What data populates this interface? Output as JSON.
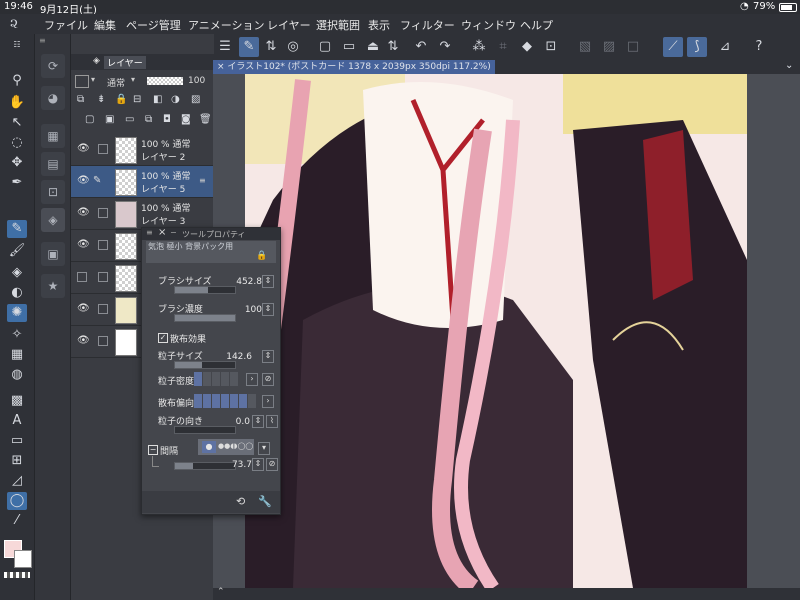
{
  "status": {
    "time": "19:46",
    "date": "9月12日(土)",
    "battery": "79%"
  },
  "menu": [
    "ファイル",
    "編集",
    "ページ管理",
    "アニメーション",
    "レイヤー",
    "選択範囲",
    "表示",
    "フィルター",
    "ウィンドウ",
    "ヘルプ"
  ],
  "layer_panel": {
    "title": "レイヤー",
    "blend_mode": "通常",
    "opacity": "100",
    "layers": [
      {
        "line1": "100 % 通常",
        "line2": "レイヤー 2",
        "selected": false
      },
      {
        "line1": "100 % 通常",
        "line2": "レイヤー 5",
        "selected": true
      },
      {
        "line1": "100 % 通常",
        "line2": "レイヤー 3",
        "selected": false
      }
    ]
  },
  "document": {
    "tab_title": "イラスト102* (ポストカード 1378 x 2039px 350dpi 117.2%)"
  },
  "tool_property": {
    "title": "ツールプロパティ",
    "subtitle": "気泡 極小 背景パック用",
    "brush_size_label": "ブラシサイズ",
    "brush_size_value": "452.8",
    "brush_size_fill": 0.55,
    "brush_density_label": "ブラシ濃度",
    "brush_density_value": "100",
    "brush_density_fill": 1.0,
    "scatter_label": "散布効果",
    "particle_size_label": "粒子サイズ",
    "particle_size_value": "142.6",
    "particle_size_fill": 0.45,
    "particle_density_label": "粒子密度",
    "particle_density_level": 1,
    "scatter_bias_label": "散布偏向",
    "scatter_bias_level": 6,
    "particle_direction_label": "粒子の向き",
    "particle_direction_value": "0.0",
    "interval_label": "間隔",
    "interval_value": "73.7",
    "interval_fill": 0.3
  },
  "colors": {
    "accent": "#4a6a9a",
    "panel": "#3a3c42",
    "bg": "#2f3137"
  }
}
